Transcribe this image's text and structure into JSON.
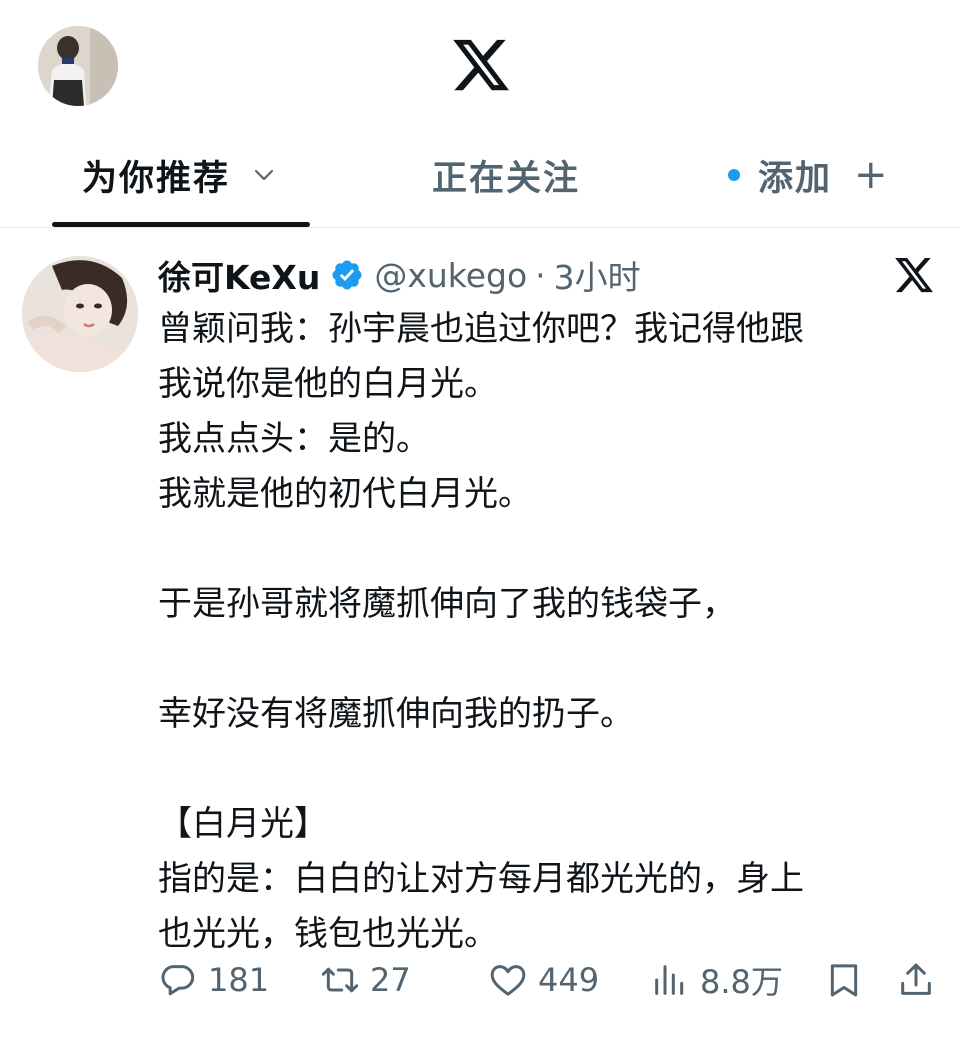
{
  "tabs": {
    "for_you": "为你推荐",
    "following": "正在关注",
    "add": "添加",
    "add_plus": "+"
  },
  "tweet": {
    "author_name": "徐可KeXu",
    "handle": "@xukego",
    "separator": "·",
    "time": "3小时",
    "lines": [
      "曾颖问我：孙宇晨也追过你吧？我记得他跟",
      "我说你是他的白月光。",
      "我点点头：是的。",
      "我就是他的初代白月光。",
      "",
      "于是孙哥就将魔抓伸向了我的钱袋子，",
      "",
      "幸好没有将魔抓伸向我的扔子。",
      "",
      "【白月光】",
      "指的是：白白的让对方每月都光光的，身上",
      "也光光，钱包也光光。"
    ],
    "stats": {
      "replies": "181",
      "retweets": "27",
      "likes": "449",
      "views": "8.8万"
    }
  },
  "icons": {
    "app_logo": "x-logo-icon",
    "post_logo": "x-logo-icon",
    "verified": "verified-badge-icon",
    "reply": "reply-icon",
    "retweet": "retweet-icon",
    "like": "heart-icon",
    "views": "views-chart-icon",
    "bookmark": "bookmark-icon",
    "share": "share-icon"
  },
  "colors": {
    "text": "#0f1419",
    "secondary": "#536471",
    "accent": "#1d9bf0"
  }
}
